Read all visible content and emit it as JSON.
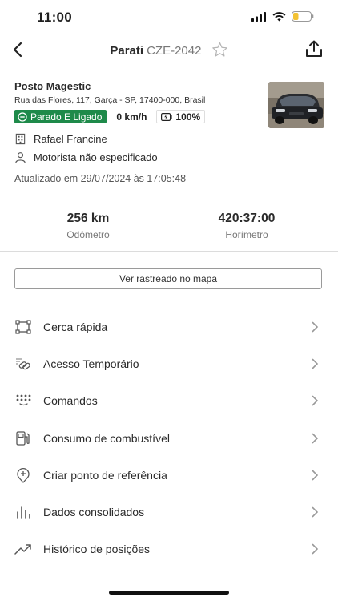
{
  "status_bar": {
    "time": "11:00"
  },
  "header": {
    "model": "Parati",
    "plate": "CZE-2042"
  },
  "location": {
    "name": "Posto Magestic",
    "address": "Rua das Flores, 117, Garça - SP, 17400-000, Brasil"
  },
  "badges": {
    "status": "Parado E Ligado",
    "speed": "0 km/h",
    "battery": "100%"
  },
  "driver": {
    "owner": "Rafael Francine",
    "motorist": "Motorista não especificado"
  },
  "updated": "Atualizado em 29/07/2024 às 17:05:48",
  "stats": {
    "odometer_value": "256 km",
    "odometer_label": "Odômetro",
    "hourmeter_value": "420:37:00",
    "hourmeter_label": "Horímetro"
  },
  "map_button": "Ver rastreado no mapa",
  "menu": [
    {
      "label": "Cerca rápida",
      "icon": "fence-icon"
    },
    {
      "label": "Acesso Temporário",
      "icon": "link-icon"
    },
    {
      "label": "Comandos",
      "icon": "keypad-icon"
    },
    {
      "label": "Consumo de combustível",
      "icon": "fuel-icon"
    },
    {
      "label": "Criar ponto de referência",
      "icon": "pin-add-icon"
    },
    {
      "label": "Dados consolidados",
      "icon": "bar-chart-icon"
    },
    {
      "label": "Histórico de posições",
      "icon": "trend-icon"
    }
  ],
  "colors": {
    "status_green": "#1e8a4a",
    "text": "#2a2a2a",
    "muted": "#777777"
  }
}
